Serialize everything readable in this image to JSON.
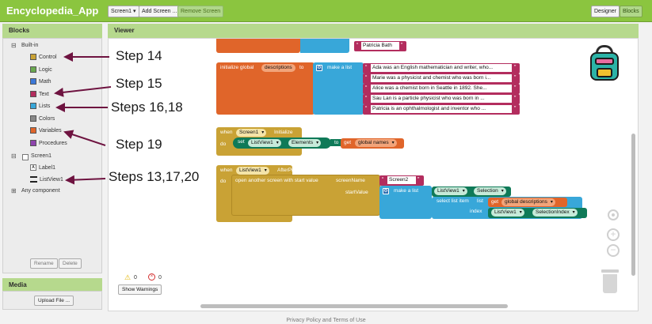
{
  "app_title": "Encyclopedia_App",
  "toolbar": {
    "screen_select": "Screen1 ▾",
    "add_screen": "Add Screen ...",
    "remove_screen": "Remove Screen",
    "designer": "Designer",
    "blocks": "Blocks"
  },
  "blocks_panel": {
    "title": "Blocks",
    "builtin_label": "Built-in",
    "builtin": [
      {
        "label": "Control",
        "color": "#c9a235"
      },
      {
        "label": "Logic",
        "color": "#6aa84f"
      },
      {
        "label": "Math",
        "color": "#3c78d8"
      },
      {
        "label": "Text",
        "color": "#b32d5e"
      },
      {
        "label": "Lists",
        "color": "#38a7d9"
      },
      {
        "label": "Colors",
        "color": "#888888"
      },
      {
        "label": "Variables",
        "color": "#e0652a"
      },
      {
        "label": "Procedures",
        "color": "#8e44ad"
      }
    ],
    "screen": "Screen1",
    "components": [
      "Label1",
      "ListView1"
    ],
    "any_component": "Any component",
    "rename": "Rename",
    "delete": "Delete"
  },
  "media": {
    "title": "Media",
    "upload": "Upload File ..."
  },
  "viewer": {
    "title": "Viewer",
    "top_string": "Patricia Bath",
    "init": {
      "label": "initialize global",
      "name": "descriptions",
      "to": "to",
      "make_list": "make a list",
      "items": [
        "Ada was an English mathematician and writer, who...",
        "Marie was a physicist and chemist who was born i...",
        "Alice was a chemist born in Seattle in 1892. She...",
        "Sau Lan is a particle physicist who was born in ...",
        "Patricia is an ophthalmologist and inventor who ..."
      ]
    },
    "initialize_event": {
      "when": "when",
      "component": "Screen1",
      "event": "Initialize",
      "do": "do",
      "set": "set",
      "target": "ListView1",
      "property": "Elements",
      "to": "to",
      "get": "get",
      "var": "global names"
    },
    "picking_event": {
      "when": "when",
      "component": "ListView1",
      "event": "AfterPicking",
      "do": "do",
      "action": "open another screen with start value",
      "screen_name_label": "screenName",
      "screen_name": "Screen2",
      "start_value_label": "startValue",
      "make_list": "make a list",
      "component2": "ListView1",
      "selection": "Selection",
      "select_item": "select list item",
      "list_label": "list",
      "get": "get",
      "var": "global descriptions",
      "index_label": "index",
      "component3": "ListView1",
      "selection_index": "SelectionIndex"
    },
    "warnings_count": "0",
    "errors_count": "0",
    "show_warnings": "Show Warnings"
  },
  "annotations": [
    "Step 14",
    "Step 15",
    "Steps 16,18",
    "Step 19",
    "Steps 13,17,20"
  ],
  "footer": "Privacy Policy and Terms of Use"
}
